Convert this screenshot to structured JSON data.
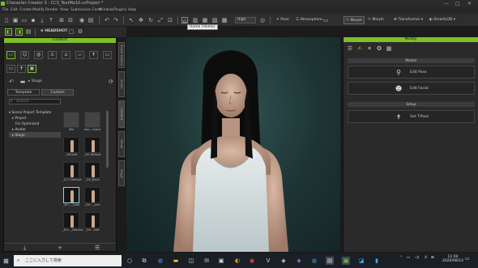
{
  "window": {
    "title": "Character Creator 3 - CC3_TextMo10.ccProject *",
    "controls": [
      "—",
      "□",
      "✕"
    ]
  },
  "menu": [
    "File",
    "Edit",
    "Create",
    "Modify",
    "Render",
    "View",
    "Submission Form",
    "Window",
    "Plugins",
    "Help"
  ],
  "toolbar": {
    "tooltip": "Home (Home)",
    "quality_select": "High",
    "pose_label": "Pose",
    "atmosphere_label": "Atmosphere",
    "morph_label": "Morph",
    "morph2_label": "Morph",
    "transformer_label": "Transformer",
    "smart_label": "SmartLOD"
  },
  "toolbar2": {
    "headshot_label": "HEADSHOT"
  },
  "content": {
    "header": "Content",
    "breadcrumb": "Stage",
    "tabs": [
      "Template",
      "Custom"
    ],
    "search_placeholder": "Search",
    "tree": [
      "Scene Project Template",
      "Project",
      "For Optimized",
      "Avatar",
      "Stage"
    ],
    "thumbs": [
      {
        "caption": "Idle"
      },
      {
        "caption": "Imp...roject"
      },
      {
        "caption": "_Default"
      },
      {
        "caption": "_Drl Default"
      },
      {
        "caption": "_CC7 Default"
      },
      {
        "caption": "_Drl_Back"
      },
      {
        "caption": "_Dri..._Gold"
      },
      {
        "caption": "_Dri..._arm"
      },
      {
        "caption": "_Dri..._Dandra"
      },
      {
        "caption": "_Dri...Soft"
      }
    ]
  },
  "sidetabs": [
    "Smart Gallery",
    "Scene",
    "Content",
    "Visual",
    "Stage"
  ],
  "modify": {
    "header": "Modify",
    "section_motion": "Motion",
    "btn_edit_pose": "Edit Pose",
    "btn_edit_facial": "Edit Facial",
    "section_setup": "Setup",
    "btn_set_tpose": "Set T-Pose"
  },
  "taskbar": {
    "search_placeholder": "ここに入力して検索",
    "time": "11:04",
    "date": "2020/08/14",
    "ime": "A"
  },
  "colors": {
    "accent": "#7fbf2a",
    "viewport_bg": "#1e3535"
  }
}
